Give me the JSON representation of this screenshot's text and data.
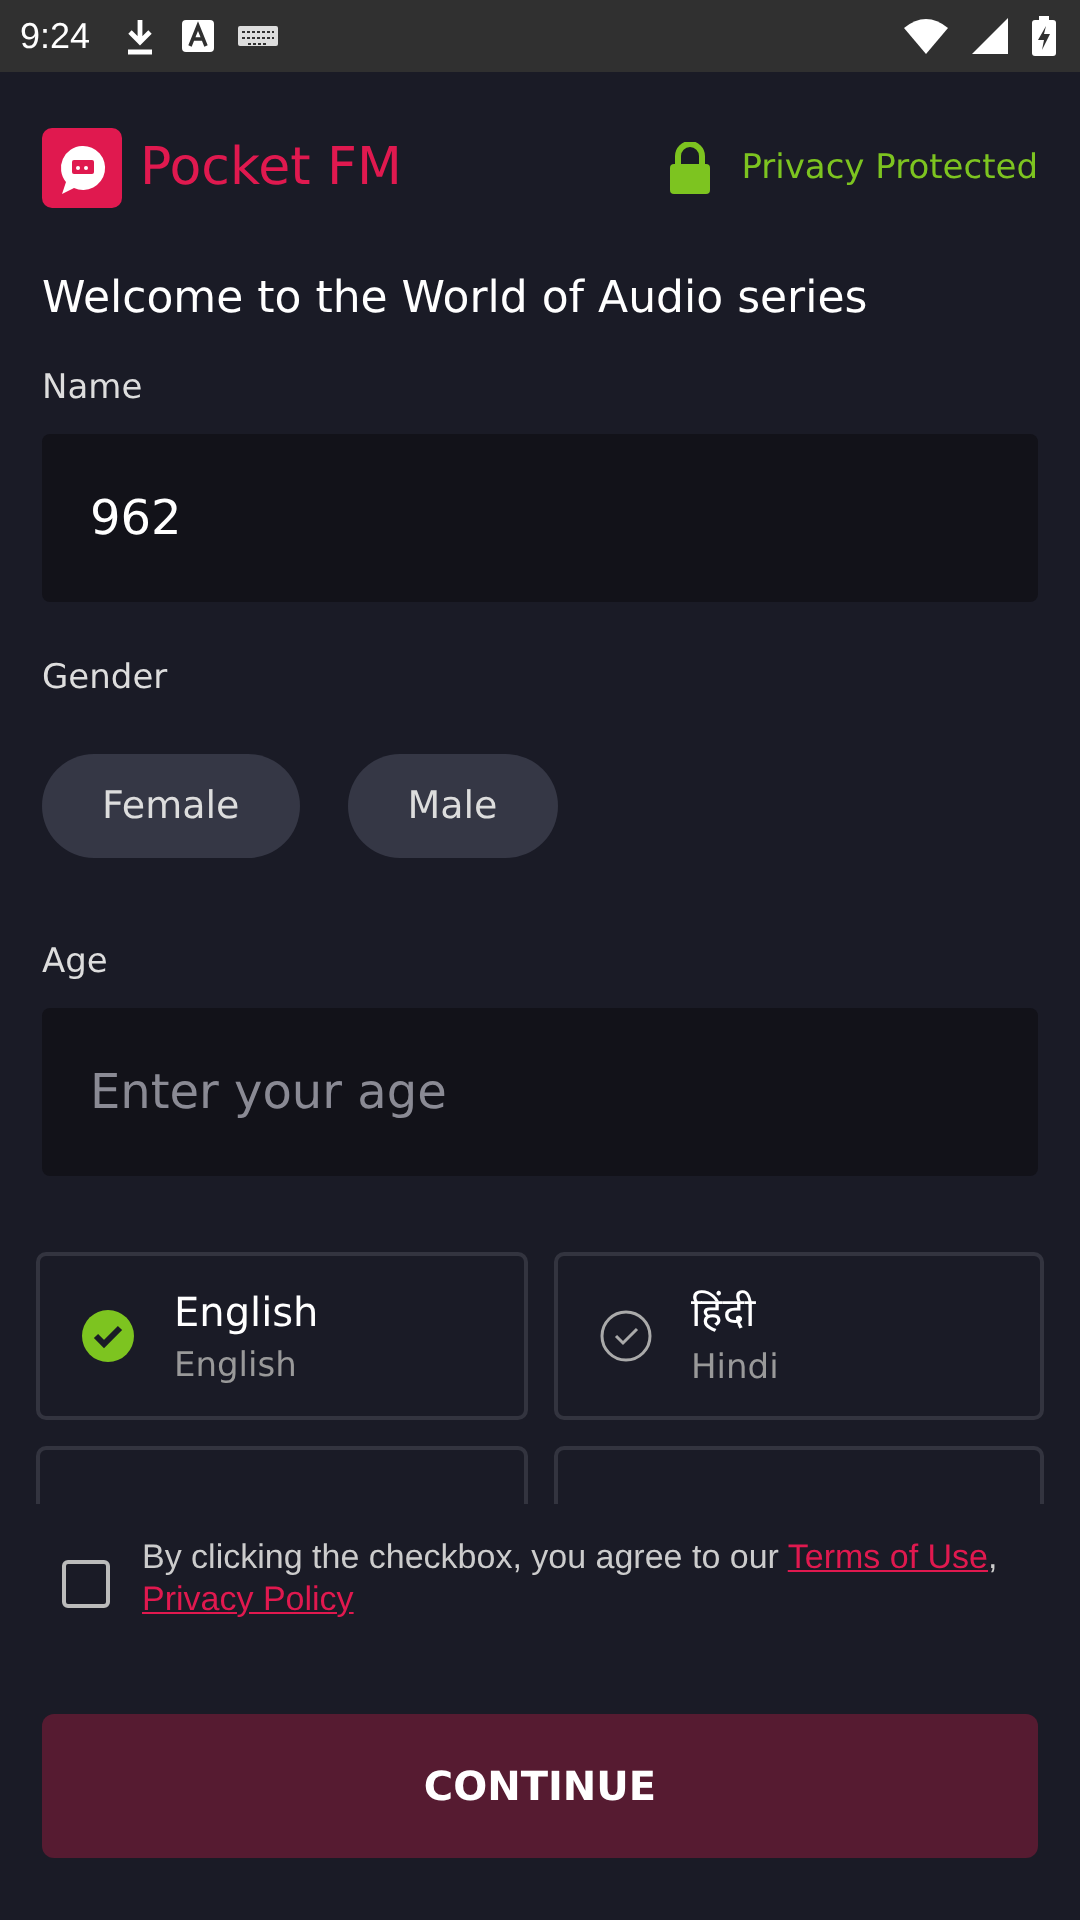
{
  "status_bar": {
    "time": "9:24"
  },
  "header": {
    "app_name": "Pocket FM",
    "privacy": "Privacy Protected"
  },
  "title": "Welcome to the World of Audio series",
  "name_field": {
    "label": "Name",
    "value": "962"
  },
  "gender": {
    "label": "Gender",
    "options": [
      {
        "label": "Female",
        "selected": false
      },
      {
        "label": "Male",
        "selected": false
      }
    ]
  },
  "age_field": {
    "label": "Age",
    "placeholder": "Enter your age"
  },
  "languages": [
    {
      "kind": "option",
      "native": "English",
      "english": "English",
      "selected": true
    },
    {
      "kind": "option",
      "native": "हिंदी",
      "english": "Hindi",
      "selected": false
    },
    {
      "kind": "cut"
    },
    {
      "kind": "cut"
    }
  ],
  "consent": {
    "checked": false,
    "text": "By clicking the checkbox, you agree to our",
    "terms_link": "Terms of Use",
    "separator": ",",
    "privacy_link": "Privacy Policy"
  },
  "continue_button": "CONTINUE"
}
